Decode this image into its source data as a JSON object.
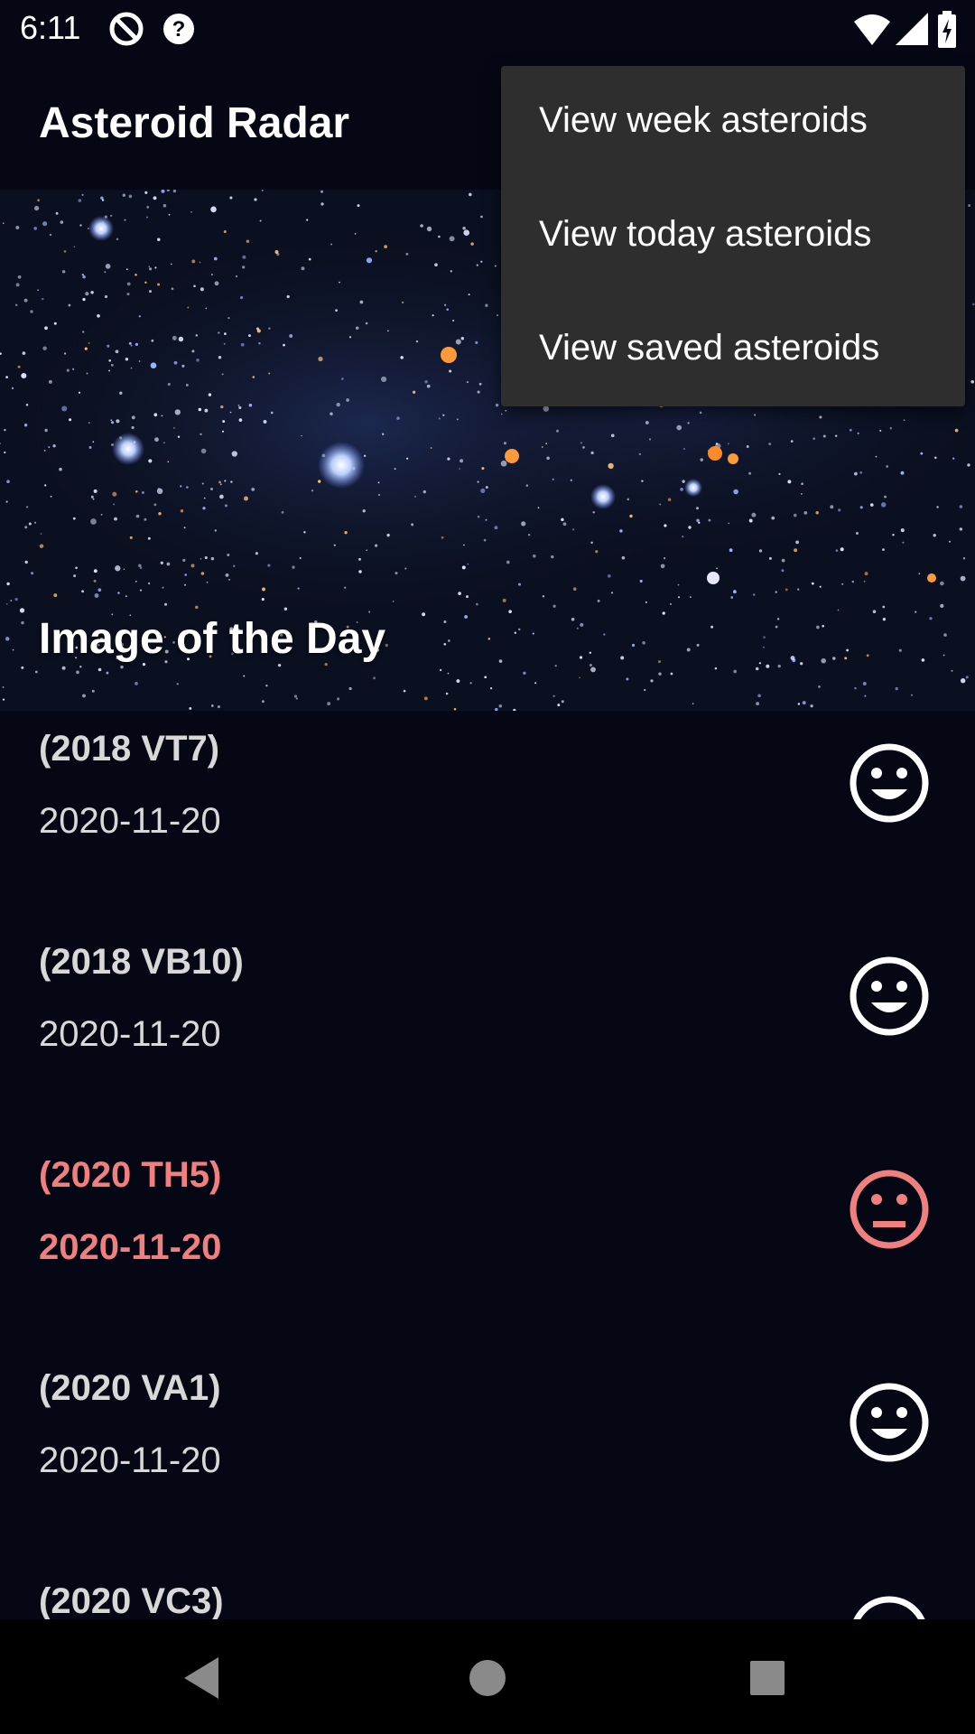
{
  "status_bar": {
    "time": "6:11",
    "icons": [
      "do-not-disturb-icon",
      "help-icon",
      "wifi-icon",
      "cell-signal-icon",
      "battery-charging-icon"
    ]
  },
  "app_bar": {
    "title": "Asteroid Radar"
  },
  "image_of_day": {
    "caption": "Image of the Day"
  },
  "menu": {
    "items": [
      "View week asteroids",
      "View today asteroids",
      "View saved asteroids"
    ]
  },
  "asteroids": [
    {
      "code": "(2018 VT7)",
      "date": "2020-11-20",
      "hazardous": false,
      "icon": "smiley-icon"
    },
    {
      "code": "(2018 VB10)",
      "date": "2020-11-20",
      "hazardous": false,
      "icon": "smiley-icon"
    },
    {
      "code": "(2020 TH5)",
      "date": "2020-11-20",
      "hazardous": true,
      "icon": "neutral-face-icon"
    },
    {
      "code": "(2020 VA1)",
      "date": "2020-11-20",
      "hazardous": false,
      "icon": "smiley-icon"
    },
    {
      "code": "(2020 VC3)",
      "date": "",
      "hazardous": false,
      "icon": "smiley-icon"
    }
  ],
  "colors": {
    "background": "#050814",
    "hazard": "#f08080",
    "normal_text": "#d8d8d8",
    "menu_bg": "#2e2e2e"
  },
  "nav_bar": {
    "icons": [
      "back-icon",
      "home-icon",
      "recents-icon"
    ]
  }
}
